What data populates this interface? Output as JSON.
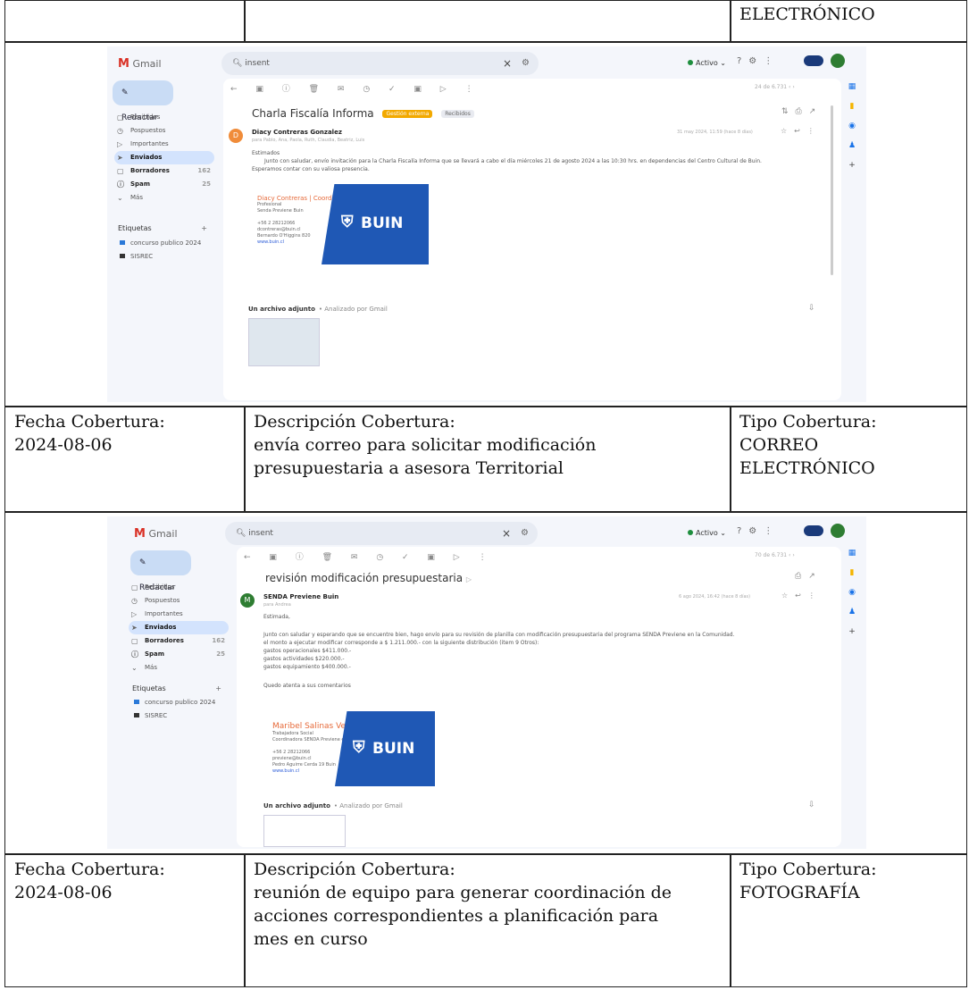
{
  "row0": {
    "tipo_cont": "ELECTRÓNICO"
  },
  "shot1": {
    "app": "Gmail",
    "search": "insent",
    "close": "×",
    "filter": "⚙",
    "status": "Activo",
    "compose": "Redactar",
    "nav": [
      {
        "icon": "▢",
        "label": "Recibidos",
        "count": ""
      },
      {
        "icon": "◷",
        "label": "Pospuestos",
        "count": ""
      },
      {
        "icon": "▷",
        "label": "Importantes",
        "count": ""
      },
      {
        "icon": "➤",
        "label": "Enviados",
        "count": ""
      },
      {
        "icon": "▢",
        "label": "Borradores",
        "count": "162"
      },
      {
        "icon": "ⓘ",
        "label": "Spam",
        "count": "25"
      },
      {
        "icon": "⌄",
        "label": "Más",
        "count": ""
      }
    ],
    "labels_title": "Etiquetas",
    "labels": [
      {
        "name": "concurso publico 2024",
        "color": "#2b79d8"
      },
      {
        "name": "SISREC",
        "color": "#333333"
      }
    ],
    "toolbar": "← ▣ ⓘ 🗑 ✉ ◷ ✓ ▣ ▷ ⋮",
    "pager": "24 de 6.731",
    "subject": "Charla Fiscalía Informa",
    "tags": [
      "Gestión externa",
      "Recibidos"
    ],
    "sender_initial": "D",
    "sender": "Diacy Contreras Gonzalez",
    "meta": "para Pablo, Ana, Paola, Ruth, Claudia, Beatriz, Luis",
    "time": "31 may 2024, 11:59 (hace 8 días)",
    "body": [
      "Estimados",
      "Junto con saludar, envío invitación para la Charla Fiscalía Informa que se llevará a cabo el día miércoles 21 de agosto 2024 a las 10:30 hrs. en dependencias del Centro Cultural de Buin.",
      "Esperamos contar con su valiosa presencia."
    ],
    "sig": {
      "name": "Diacy Contreras | Coordinadora Territorial",
      "lines": [
        "Profesional",
        "Senda Previene Buin",
        "",
        "+56 2 28212066",
        "dcontreras@buin.cl",
        "Bernardo O'Higgins 820"
      ],
      "link": "www.buin.cl"
    },
    "brand": "BUIN",
    "attach_title": "Un archivo adjunto",
    "attach_scan": "• Analizado por Gmail"
  },
  "row1": {
    "fecha_label": "Fecha Cobertura:",
    "fecha": "2024-08-06",
    "desc_label": "Descripción Cobertura:",
    "desc_l1": "envía correo para solicitar modificación",
    "desc_l2": "presupuestaria a asesora Territorial",
    "tipo_label": "Tipo Cobertura:",
    "tipo_l1": "CORREO",
    "tipo_l2": "ELECTRÓNICO"
  },
  "shot2": {
    "app": "Gmail",
    "search": "insent",
    "close": "×",
    "filter": "⚙",
    "status": "Activo",
    "compose": "Redactar",
    "nav": [
      {
        "icon": "▢",
        "label": "Recibidos",
        "count": ""
      },
      {
        "icon": "◷",
        "label": "Pospuestos",
        "count": ""
      },
      {
        "icon": "▷",
        "label": "Importantes",
        "count": ""
      },
      {
        "icon": "➤",
        "label": "Enviados",
        "count": ""
      },
      {
        "icon": "▢",
        "label": "Borradores",
        "count": "162"
      },
      {
        "icon": "ⓘ",
        "label": "Spam",
        "count": "25"
      },
      {
        "icon": "⌄",
        "label": "Más",
        "count": ""
      }
    ],
    "labels_title": "Etiquetas",
    "labels": [
      {
        "name": "concurso publico 2024",
        "color": "#2b79d8"
      },
      {
        "name": "SISREC",
        "color": "#333333"
      }
    ],
    "toolbar": "← ▣ ⓘ 🗑 ✉ ◷ ✓ ▣ ▷ ⋮",
    "pager": "70 de 6.731",
    "subject": "revisión modificación presupuestaria",
    "sender_initial": "M",
    "sender": "SENDA Previene Buin",
    "meta": "para Andrea",
    "time": "6 ago 2024, 16:42 (hace 8 días)",
    "body": [
      "Estimada,",
      "Junto con saludar y esperando que se encuentre bien, hago envío para su revisión de planilla con modificación presupuestaria del programa SENDA Previene en la Comunidad.",
      "el monto a ejecutar modificar corresponde a $ 1.211.000.- con la siguiente distribución (item 9 Otros):",
      "gastos operacionales $411.000.-",
      "gastos actividades $220.000.-",
      "gastos equipamiento $400.000.-",
      "",
      "Quedo atenta a sus comentarios"
    ],
    "sig": {
      "name": "Maribel Salinas Vergara",
      "lines": [
        "Trabajadora Social",
        "Coordinadora SENDA Previene en la Comunidad Buin",
        "",
        "+56 2 28212066",
        "previene@buin.cl",
        "Pedro Aguirre Cerda 19 Buin"
      ],
      "link": "www.buin.cl"
    },
    "brand": "BUIN",
    "attach_title": "Un archivo adjunto",
    "attach_scan": "• Analizado por Gmail"
  },
  "row2": {
    "fecha_label": "Fecha Cobertura:",
    "fecha": "2024-08-06",
    "desc_label": "Descripción Cobertura:",
    "desc_l1": "reunión de equipo para generar coordinación de",
    "desc_l2": "acciones correspondientes a planificación para",
    "desc_l3": "mes en curso",
    "tipo_label": "Tipo Cobertura:",
    "tipo_l1": "FOTOGRAFÍA"
  }
}
